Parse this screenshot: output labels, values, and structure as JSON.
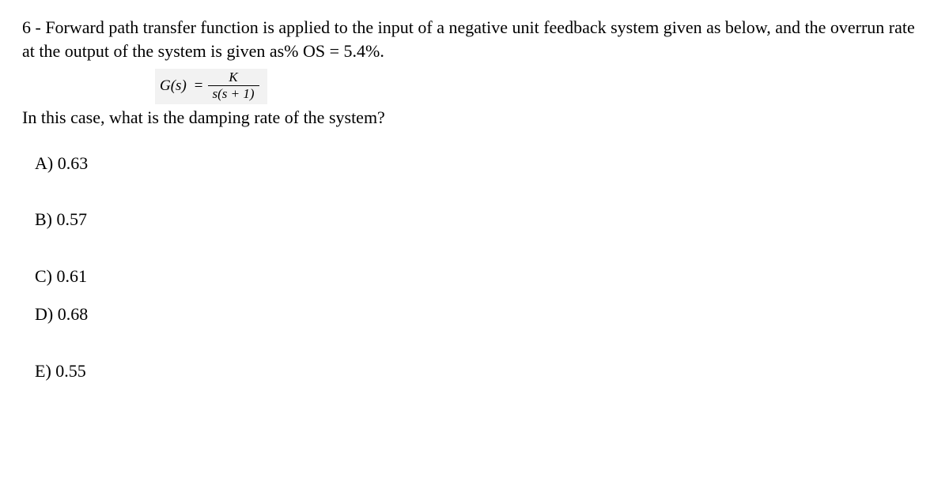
{
  "question": {
    "line1": "6 - Forward path transfer function is applied to the input of a negative unit feedback system given as below, and the overrun rate at the output of the system is given as% OS = 5.4%.",
    "formula_lhs": "G(s)",
    "formula_eq": "=",
    "formula_num": "K",
    "formula_den": "s(s + 1)",
    "line2": "In this case, what is the damping rate of the system?"
  },
  "options": {
    "a": "A) 0.63",
    "b": "B) 0.57",
    "c": "C) 0.61",
    "d": "D) 0.68",
    "e": "E) 0.55"
  }
}
